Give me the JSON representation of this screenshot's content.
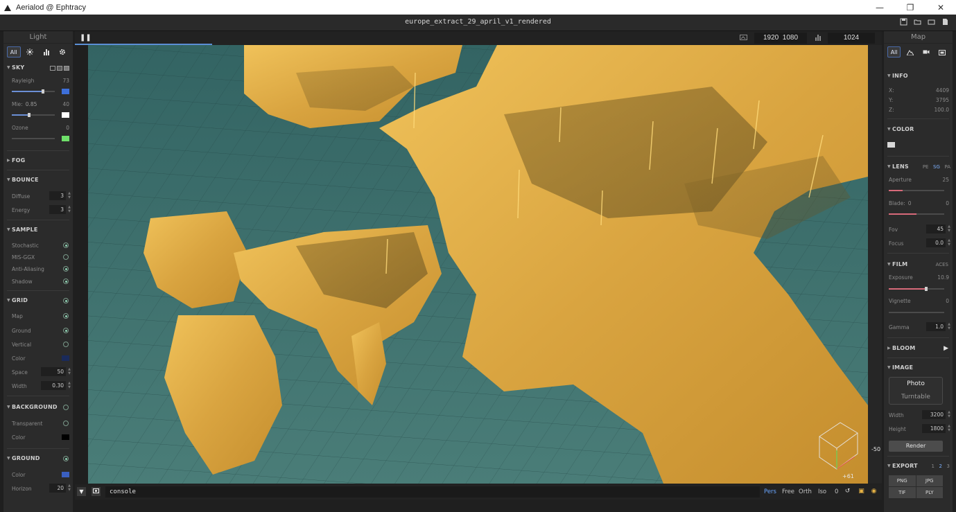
{
  "titlebar": {
    "title": "Aerialod @ Ephtracy",
    "minimize": "—",
    "restore": "❐",
    "close": "✕"
  },
  "document": {
    "name": "europe_extract_29_april_v1_rendered"
  },
  "viewbar": {
    "res_width": "1920",
    "res_height": "1080",
    "samples": "1024",
    "progress_pct": 17
  },
  "left_panel": {
    "title": "Light",
    "tabs": [
      {
        "label": "All",
        "icon": "all"
      },
      {
        "label": "",
        "icon": "sun-icon"
      },
      {
        "label": "",
        "icon": "bars-icon"
      },
      {
        "label": "",
        "icon": "gear-icon"
      }
    ],
    "sky": {
      "label": "SKY",
      "rayleigh_label": "Rayleigh",
      "rayleigh_value": "73",
      "rayleigh_level": 0.73,
      "rayleigh_color": "#3d6fd9",
      "mie_label": "Mie:",
      "mie_g": "0.85",
      "mie_value": "40",
      "mie_level": 0.4,
      "mie_color": "#ffffff",
      "ozone_label": "Ozone",
      "ozone_value": "0",
      "ozone_level": 0.0,
      "ozone_color": "#6fe06a"
    },
    "fog": {
      "label": "FOG"
    },
    "bounce": {
      "label": "BOUNCE",
      "diffuse_label": "Diffuse",
      "diffuse_value": "3",
      "energy_label": "Energy",
      "energy_value": "3"
    },
    "sample": {
      "label": "SAMPLE",
      "items": [
        "Stochastic",
        "MIS-GGX",
        "Anti-Aliasing",
        "Shadow"
      ]
    },
    "grid": {
      "label": "GRID",
      "map_label": "Map",
      "ground_label": "Ground",
      "vertical_label": "Vertical",
      "color_label": "Color",
      "color": "#1a2a5a",
      "space_label": "Space",
      "space_value": "50",
      "width_label": "Width",
      "width_value": "0.30"
    },
    "background": {
      "label": "BACKGROUND",
      "transparent_label": "Transparent",
      "color_label": "Color",
      "color": "#000000"
    },
    "ground": {
      "label": "GROUND",
      "color_label": "Color",
      "color": "#3a5fc0",
      "horizon_label": "Horizon",
      "horizon_value": "20"
    }
  },
  "right_panel": {
    "title": "Map",
    "tabs": [
      {
        "label": "All",
        "icon": "all"
      },
      {
        "label": "",
        "icon": "terrain-icon"
      },
      {
        "label": "",
        "icon": "camera-icon"
      },
      {
        "label": "",
        "icon": "image-icon"
      }
    ],
    "info": {
      "label": "INFO",
      "x_label": "X:",
      "x_value": "4409",
      "y_label": "Y:",
      "y_value": "3795",
      "z_label": "Z:",
      "z_value": "100.0"
    },
    "color": {
      "label": "COLOR",
      "swatch": "#d8d8d8"
    },
    "lens": {
      "label": "LENS",
      "modes": [
        "PE",
        "SG",
        "PA"
      ],
      "active_mode": "SG",
      "aperture_label": "Aperture",
      "aperture_value": "25",
      "aperture_level": 0.25,
      "blade_label": "Blade:",
      "blade_count": "0",
      "blade_value": "0",
      "blade_level": 0.5,
      "fov_label": "Fov",
      "fov_value": "45",
      "focus_label": "Focus",
      "focus_value": "0.0"
    },
    "film": {
      "label": "FILM",
      "mode": "ACES",
      "exposure_label": "Exposure",
      "exposure_value": "10.9",
      "exposure_level": 0.68,
      "vignette_label": "Vignette",
      "vignette_value": "0",
      "vignette_level": 0.0,
      "gamma_label": "Gamma",
      "gamma_value": "1.0"
    },
    "bloom": {
      "label": "BLOOM",
      "play": "▶"
    },
    "image": {
      "label": "IMAGE",
      "option1": "Photo",
      "option2": "Turntable",
      "width_label": "Width",
      "width_value": "3200",
      "height_label": "Height",
      "height_value": "1800",
      "render_label": "Render"
    },
    "export": {
      "label": "EXPORT",
      "pages": [
        "1",
        "2",
        "3"
      ],
      "active_page": "2",
      "formats": [
        "PNG",
        "JPG",
        "TIF",
        "PLY"
      ]
    }
  },
  "viewport": {
    "axis_neg": "-50",
    "axis_pos": "+61"
  },
  "console": {
    "value": "console",
    "cam_modes": [
      "Pers",
      "Free",
      "Orth",
      "Iso"
    ],
    "active_cam": "Pers",
    "cam_value": "0"
  },
  "colors": {
    "accent": "#5b8fd6",
    "terrain": "#e7b64a",
    "sea": "#3f6c6b"
  }
}
